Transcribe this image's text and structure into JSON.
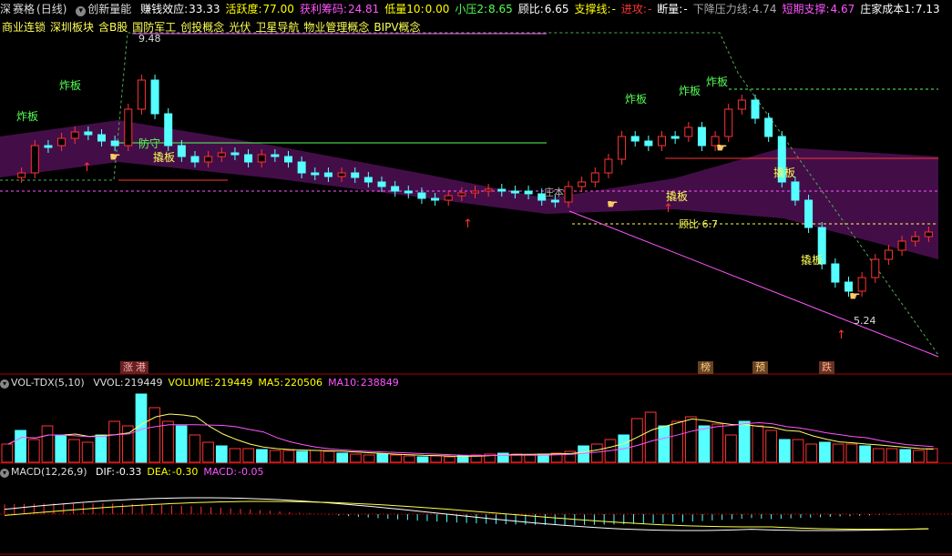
{
  "header": {
    "market": "深",
    "name": "赛格",
    "period": "(日线)",
    "indicator": "创新量能",
    "fields": [
      {
        "label": "赚钱效应:",
        "value": "33.33",
        "color": "#ffffff"
      },
      {
        "label": "活跃度:",
        "value": "77.00",
        "color": "#ffff00"
      },
      {
        "label": "获利筹码:",
        "value": "24.81",
        "color": "#ff55ff"
      },
      {
        "label": "低量10:",
        "value": "0.00",
        "color": "#ffff00"
      },
      {
        "label": "小压2:",
        "value": "8.65",
        "color": "#55ff55"
      },
      {
        "label": "顾比:",
        "value": "6.65",
        "color": "#ffffff"
      },
      {
        "label": "支撑线:",
        "value": "-",
        "color": "#ffff00"
      },
      {
        "label": "进攻:",
        "value": "-",
        "color": "#ff3333"
      },
      {
        "label": "断量:",
        "value": "-",
        "color": "#ffffff"
      },
      {
        "label": "下降压力线:",
        "value": "4.74",
        "color": "#aaaaaa"
      },
      {
        "label": "短期支撑:",
        "value": "4.67",
        "color": "#ff55ff"
      },
      {
        "label": "庄家成本1:",
        "value": "7.13",
        "color": "#ffffff"
      }
    ]
  },
  "concepts": [
    "商业连锁",
    "深圳板块",
    "含B股",
    "国防军工",
    "创投概念",
    "光伏",
    "卫星导航",
    "物业管理概念",
    "BIPV概念"
  ],
  "price_panel": {
    "high_label": "9.48",
    "low_label": "5.24",
    "gubi_label": "顾比 6.7",
    "cost_label": "庄本",
    "signals": [
      "炸板",
      "炸板",
      "防守",
      "撬板",
      "炸板",
      "炸板",
      "炸板",
      "撬板",
      "撬板",
      "撬板",
      "撬板"
    ],
    "bottom_tags": [
      {
        "text": "涨",
        "color": "#ff4444"
      },
      {
        "text": "港",
        "color": "#ff4444"
      },
      {
        "text": "榜",
        "color": "#ff4444"
      },
      {
        "text": "预",
        "color": "#ff4444"
      },
      {
        "text": "跌",
        "color": "#55ff55"
      }
    ]
  },
  "volume_panel": {
    "title": "VOL-TDX(5,10)",
    "fields": [
      {
        "label": "VVOL:",
        "value": "219449",
        "color": "#dddddd"
      },
      {
        "label": "VOLUME:",
        "value": "219449",
        "color": "#ffff00"
      },
      {
        "label": "MA5:",
        "value": "220506",
        "color": "#ffff00"
      },
      {
        "label": "MA10:",
        "value": "238849",
        "color": "#ff55ff"
      }
    ]
  },
  "macd_panel": {
    "title": "MACD(12,26,9)",
    "fields": [
      {
        "label": "DIF:",
        "value": "-0.33",
        "color": "#ffffff"
      },
      {
        "label": "DEA:",
        "value": "-0.30",
        "color": "#ffff00"
      },
      {
        "label": "MACD:",
        "value": "-0.05",
        "color": "#ff55ff"
      }
    ]
  },
  "colors": {
    "up": "#ff3333",
    "down": "#55ffff",
    "grid": "#aa0000",
    "ma_purple": "#ff44ff"
  }
}
